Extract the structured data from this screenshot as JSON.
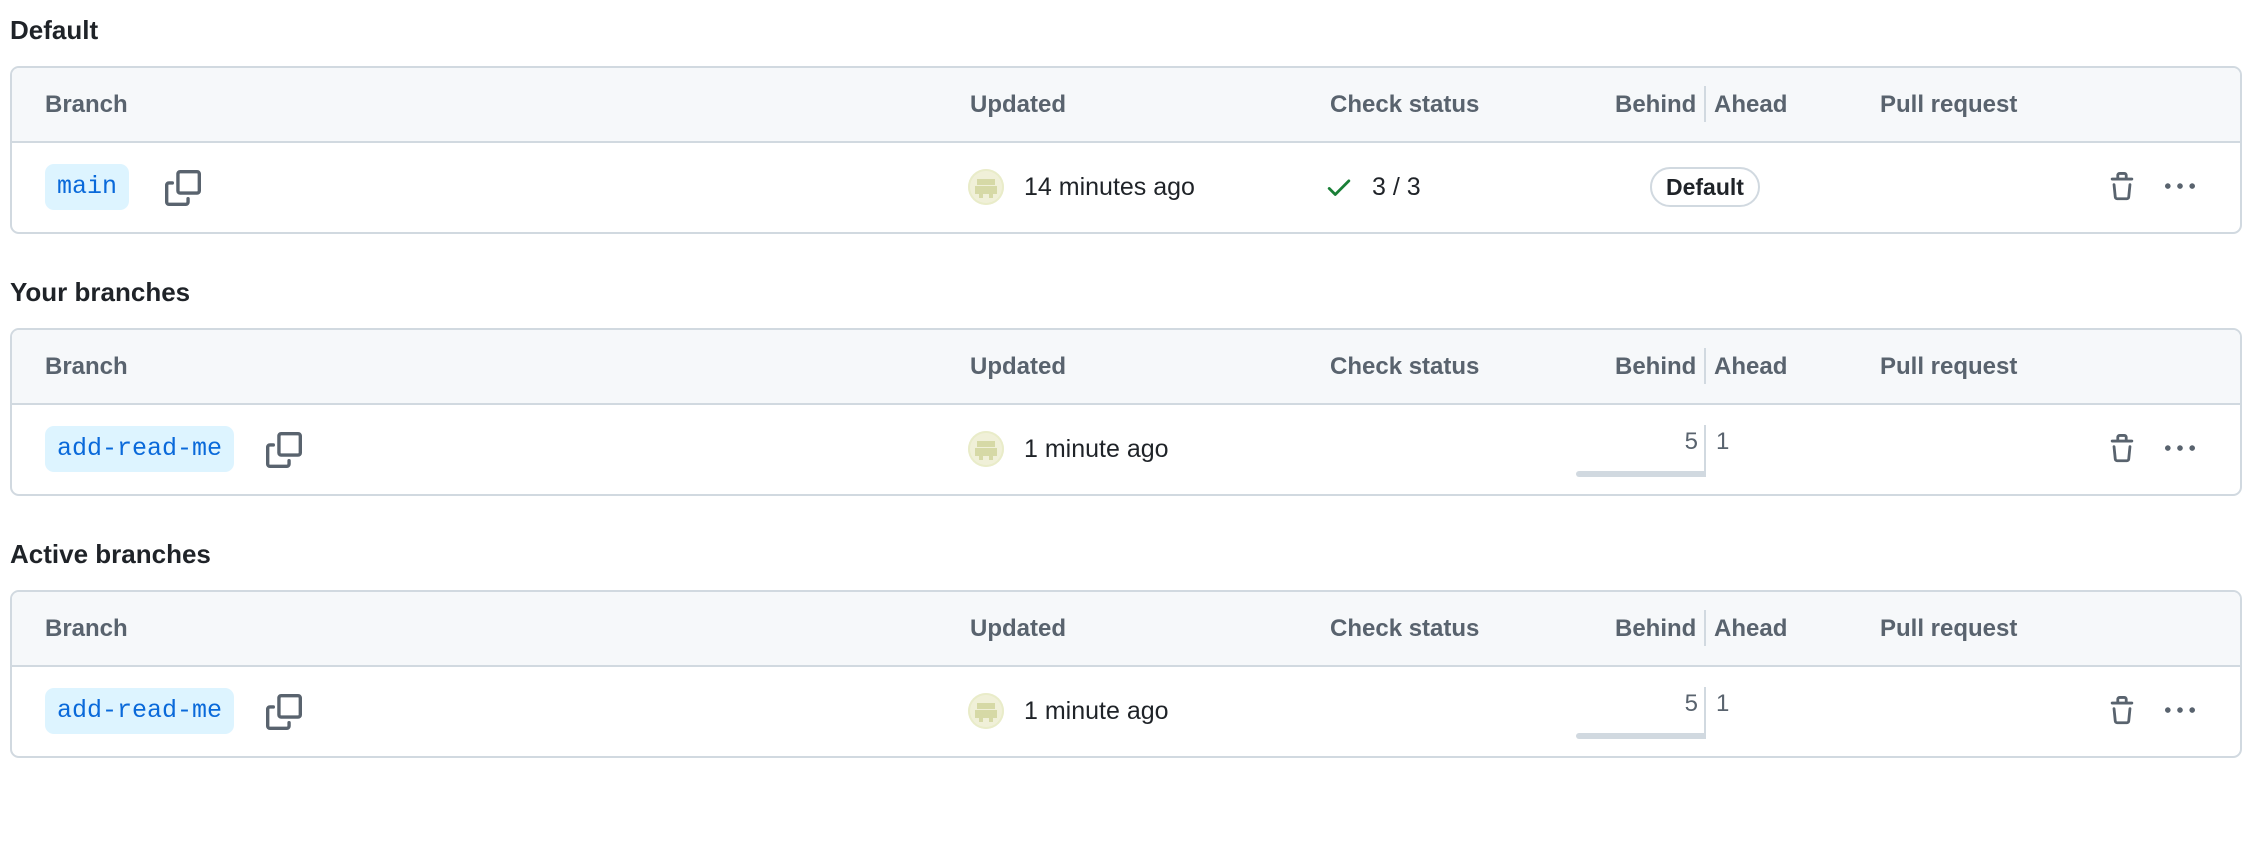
{
  "columns": {
    "branch": "Branch",
    "updated": "Updated",
    "check_status": "Check status",
    "behind": "Behind",
    "ahead": "Ahead",
    "pull_request": "Pull request"
  },
  "colors": {
    "branch_text": "#0969da",
    "branch_bg": "#ddf4ff",
    "success": "#1a7f37",
    "border": "#d1d9e0",
    "header_bg": "#f6f8fa"
  },
  "sections": [
    {
      "title": "Default",
      "rows": [
        {
          "branch": "main",
          "updated": "14 minutes ago",
          "check_status": "3 / 3",
          "badge": "Default"
        }
      ]
    },
    {
      "title": "Your branches",
      "rows": [
        {
          "branch": "add-read-me",
          "updated": "1 minute ago",
          "behind": "5",
          "ahead": "1"
        }
      ]
    },
    {
      "title": "Active branches",
      "rows": [
        {
          "branch": "add-read-me",
          "updated": "1 minute ago",
          "behind": "5",
          "ahead": "1"
        }
      ]
    }
  ],
  "icons": {
    "copy": "copy-icon",
    "check": "check-icon",
    "trash": "trash-icon",
    "more": "kebab-horizontal-icon",
    "avatar": "avatar"
  }
}
